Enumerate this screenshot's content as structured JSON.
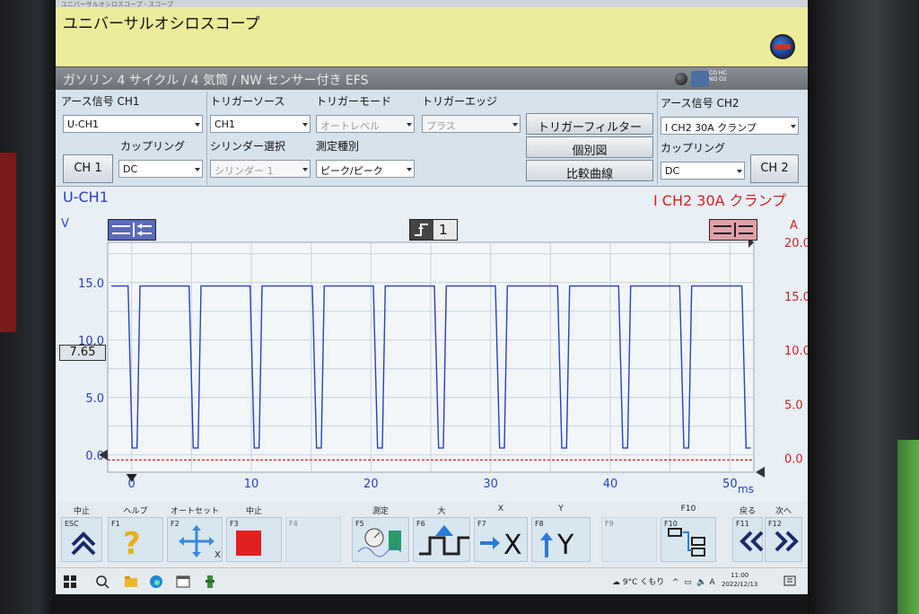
{
  "app": {
    "window_title": "ユニバーサルオシロスコープ - スコープ",
    "title": "ユニバーサルオシロスコープ"
  },
  "vehicle": {
    "description": "ガソリン 4 サイクル / 4 気筒 / NW センサー付き EFS",
    "emission_label": "CO HC NO O2"
  },
  "settings": {
    "ch1_ground_label": "アース信号 CH1",
    "ch1_ground_value": "U-CH1",
    "ch1_button": "CH 1",
    "ch1_coupling_label": "カップリング",
    "ch1_coupling_value": "DC",
    "trigger_source_label": "トリガーソース",
    "trigger_source_value": "CH1",
    "cylinder_label": "シリンダー選択",
    "cylinder_value": "シリンダー 1",
    "trigger_mode_label": "トリガーモード",
    "trigger_mode_value": "オートレベル",
    "measure_type_label": "測定種別",
    "measure_type_value": "ピーク/ピーク",
    "trigger_edge_label": "トリガーエッジ",
    "trigger_edge_value": "プラス",
    "trigger_filter_button": "トリガーフィルター",
    "individual_view_button": "個別図",
    "compare_curve_button": "比較曲線",
    "ch2_ground_label": "アース信号 CH2",
    "ch2_ground_value": "I CH2 30A クランプ",
    "ch2_coupling_label": "カップリング",
    "ch2_coupling_value": "DC",
    "ch2_button": "CH 2"
  },
  "scope": {
    "ch1_title": "U-CH1",
    "ch2_title": "I CH2 30A クランプ",
    "ch1_unit": "V",
    "ch2_unit": "A",
    "ch1_level_readout": "7.65",
    "trigger_channel": "1",
    "x_unit": "ms",
    "colors": {
      "ch1": "#2a3fbf",
      "ch2": "#d02020",
      "grid": "#c8d2dc"
    }
  },
  "chart_data": {
    "type": "line",
    "title": "",
    "xlabel": "ms",
    "ylabel": "V",
    "y2label": "A",
    "xlim": [
      -2,
      52
    ],
    "ylim": [
      -1.5,
      18.5
    ],
    "y2lim": [
      -1.3,
      20
    ],
    "x_ticks": [
      0,
      10,
      20,
      30,
      40,
      50
    ],
    "y_ticks": [
      0.0,
      5.0,
      10.0,
      15.0
    ],
    "y_tick_labels": [
      "0.0",
      "5.0",
      "10.0",
      "15.0"
    ],
    "y2_ticks": [
      0.0,
      5.0,
      10.0,
      15.0,
      20.0
    ],
    "y2_tick_labels": [
      "0.0",
      "5.0",
      "10.0",
      "15.0",
      "20.0"
    ],
    "grid": true,
    "series": [
      {
        "axis": "left",
        "high_level": 14.7,
        "low_level": 0.6,
        "pulse_low_ms": [
          -0.3,
          4.8,
          9.9,
          15.1,
          20.2,
          25.3,
          30.4,
          35.6,
          40.7,
          45.8,
          51.0
        ],
        "pulse_fall_ms": 0.35,
        "pulse_bottom_ms": 0.4,
        "pulse_rise_ms": 0.25
      },
      {
        "axis": "right",
        "values_x": [
          -2,
          52
        ],
        "values_y": [
          0.0,
          0.0
        ]
      }
    ]
  },
  "fkeys": [
    {
      "id": "ESC",
      "top": "中止",
      "icon": "double-chevron-up-icon"
    },
    {
      "id": "F1",
      "top": "ヘルプ",
      "icon": "question-mark-icon"
    },
    {
      "id": "F2",
      "top": "オートセットアップ",
      "icon": "auto-setup-icon"
    },
    {
      "id": "F3",
      "top": "中止",
      "icon": "stop-square-icon"
    },
    {
      "id": "F4",
      "top": "",
      "icon": ""
    },
    {
      "id": "F5",
      "top": "測定",
      "icon": "measure-icon"
    },
    {
      "id": "F6",
      "top": "大",
      "icon": "square-wave-icon"
    },
    {
      "id": "F7",
      "top": "X",
      "icon": "arrow-right-x-icon",
      "label": "X"
    },
    {
      "id": "F8",
      "top": "Y",
      "icon": "arrow-up-y-icon",
      "label": "Y"
    },
    {
      "id": "F9",
      "top": "",
      "icon": ""
    },
    {
      "id": "F10",
      "top": "F10",
      "icon": "channel-select-icon"
    },
    {
      "id": "F11",
      "top": "戻る",
      "icon": "double-chevron-left-icon"
    },
    {
      "id": "F12",
      "top": "次へ",
      "icon": "double-chevron-right-icon"
    }
  ],
  "taskbar": {
    "weather": "9°C くもり",
    "ime": "A",
    "time": "11:00",
    "date": "2022/12/13"
  }
}
